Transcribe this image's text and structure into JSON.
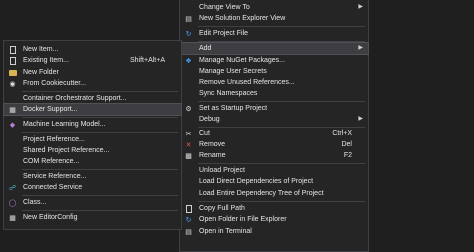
{
  "right_menu": {
    "items": [
      {
        "label": "Change View To",
        "shortcut": "",
        "submenu": true
      },
      {
        "label": "New Solution Explorer View",
        "shortcut": "",
        "submenu": false
      },
      {
        "label": "Edit Project File",
        "shortcut": "",
        "submenu": false
      },
      {
        "label": "Add",
        "shortcut": "",
        "submenu": true
      },
      {
        "label": "Manage NuGet Packages...",
        "shortcut": "",
        "submenu": false
      },
      {
        "label": "Manage User Secrets",
        "shortcut": "",
        "submenu": false
      },
      {
        "label": "Remove Unused References...",
        "shortcut": "",
        "submenu": false
      },
      {
        "label": "Sync Namespaces",
        "shortcut": "",
        "submenu": false
      },
      {
        "label": "Set as Startup Project",
        "shortcut": "",
        "submenu": false
      },
      {
        "label": "Debug",
        "shortcut": "",
        "submenu": true
      },
      {
        "label": "Cut",
        "shortcut": "Ctrl+X",
        "submenu": false
      },
      {
        "label": "Remove",
        "shortcut": "Del",
        "submenu": false
      },
      {
        "label": "Rename",
        "shortcut": "F2",
        "submenu": false
      },
      {
        "label": "Unload Project",
        "shortcut": "",
        "submenu": false
      },
      {
        "label": "Load Direct Dependencies of Project",
        "shortcut": "",
        "submenu": false
      },
      {
        "label": "Load Entire Dependency Tree of Project",
        "shortcut": "",
        "submenu": false
      },
      {
        "label": "Copy Full Path",
        "shortcut": "",
        "submenu": false
      },
      {
        "label": "Open Folder in File Explorer",
        "shortcut": "",
        "submenu": false
      },
      {
        "label": "Open in Terminal",
        "shortcut": "",
        "submenu": false
      }
    ]
  },
  "left_menu": {
    "items": [
      {
        "label": "New Item...",
        "shortcut": ""
      },
      {
        "label": "Existing Item...",
        "shortcut": "Shift+Alt+A"
      },
      {
        "label": "New Folder",
        "shortcut": ""
      },
      {
        "label": "From Cookiecutter...",
        "shortcut": ""
      },
      {
        "label": "Container Orchestrator Support...",
        "shortcut": ""
      },
      {
        "label": "Docker Support...",
        "shortcut": ""
      },
      {
        "label": "Machine Learning Model...",
        "shortcut": ""
      },
      {
        "label": "Project Reference...",
        "shortcut": ""
      },
      {
        "label": "Shared Project Reference...",
        "shortcut": ""
      },
      {
        "label": "COM Reference...",
        "shortcut": ""
      },
      {
        "label": "Service Reference...",
        "shortcut": ""
      },
      {
        "label": "Connected Service",
        "shortcut": ""
      },
      {
        "label": "Class...",
        "shortcut": ""
      },
      {
        "label": "New EditorConfig",
        "shortcut": ""
      }
    ]
  }
}
